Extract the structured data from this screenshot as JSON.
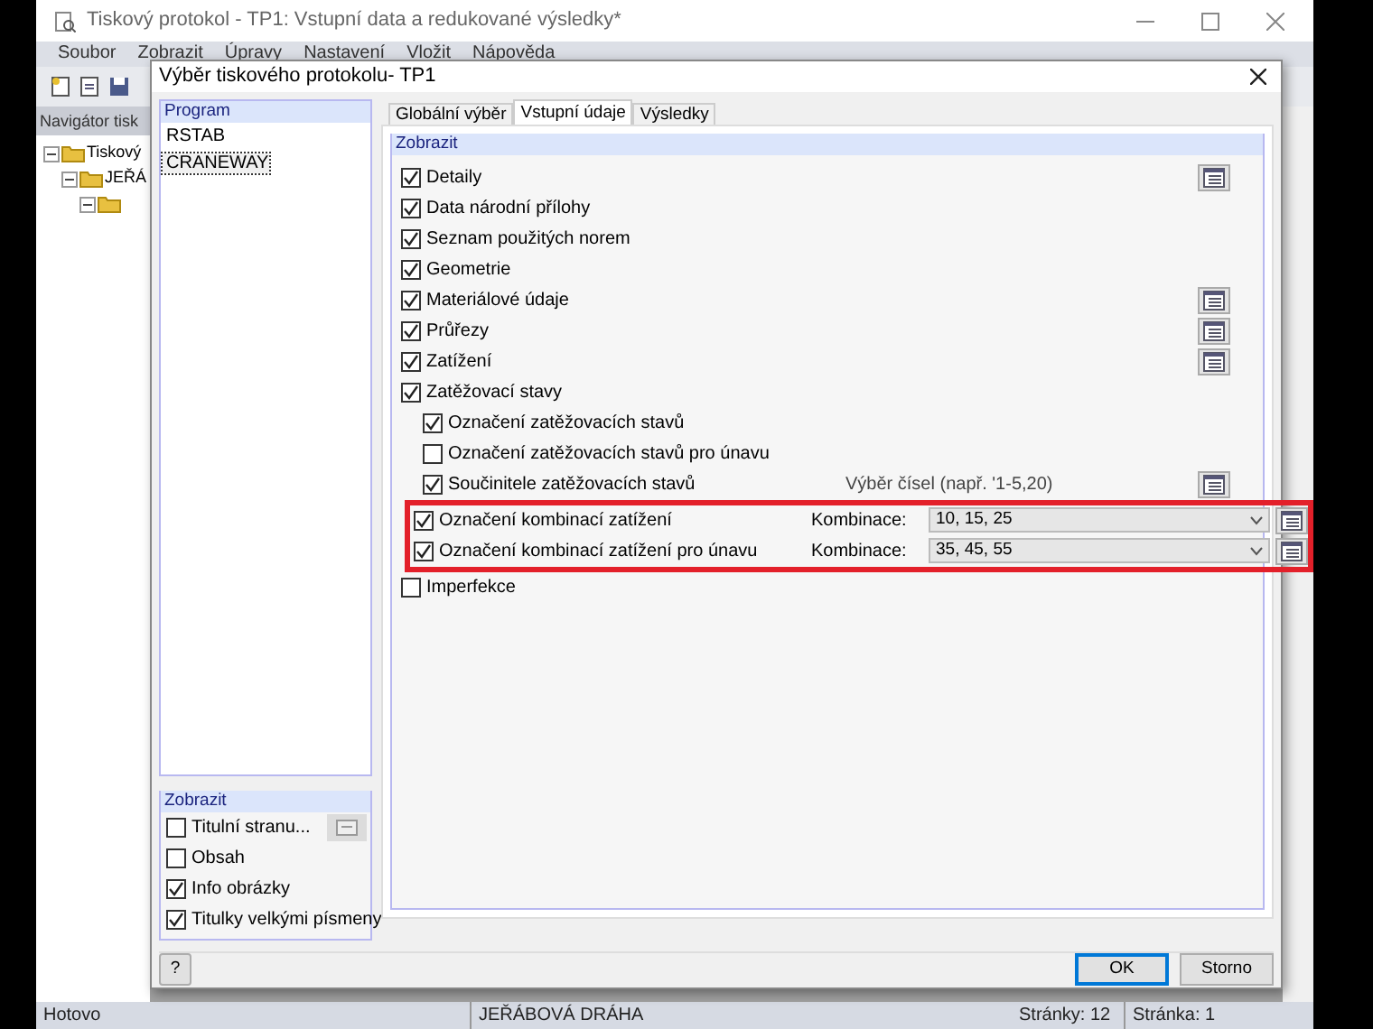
{
  "app": {
    "title": "Tiskový protokol - TP1: Vstupní data a redukované výsledky*",
    "menu": [
      "Soubor",
      "Zobrazit",
      "Úpravy",
      "Nastavení",
      "Vložit",
      "Nápověda"
    ],
    "navigator": {
      "title": "Navigátor tisk",
      "tree": [
        {
          "label": "Tiskový",
          "expanded": true,
          "children": [
            {
              "label": "JEŘÁ",
              "expanded": true,
              "children": [
                {
                  "expanded": true
                }
              ]
            }
          ]
        }
      ]
    },
    "status_bar": [
      "Hotovo",
      "JEŘÁBOVÁ DRÁHA",
      "Stránky: 12",
      "Stránka: 1"
    ]
  },
  "dialog": {
    "title": "Výběr tiskového protokolu- TP1",
    "program": {
      "header": "Program",
      "items": [
        {
          "label": "RSTAB",
          "selected": false
        },
        {
          "label": "CRANEWAY",
          "selected": true
        }
      ]
    },
    "display": {
      "header": "Zobrazit",
      "items": [
        {
          "label": "Titulní stranu...",
          "checked": false,
          "settings_button": true
        },
        {
          "label": "Obsah",
          "checked": false,
          "settings_button": false
        },
        {
          "label": "Info obrázky",
          "checked": true,
          "settings_button": false
        },
        {
          "label": "Titulky velkými písmeny",
          "checked": true,
          "settings_button": false
        }
      ]
    },
    "tabs": [
      {
        "label": "Globální výběr",
        "selected": false
      },
      {
        "label": "Vstupní údaje",
        "selected": true
      },
      {
        "label": "Výsledky",
        "selected": false
      }
    ],
    "section": {
      "header": "Zobrazit",
      "items": [
        {
          "label": "Detaily",
          "checked": true,
          "list_button": true
        },
        {
          "label": "Data národní přílohy",
          "checked": true,
          "list_button": false
        },
        {
          "label": "Seznam použitých norem",
          "checked": true,
          "list_button": false
        },
        {
          "label": "Geometrie",
          "checked": true,
          "list_button": false
        },
        {
          "label": "Materiálové údaje",
          "checked": true,
          "list_button": true
        },
        {
          "label": "Průřezy",
          "checked": true,
          "list_button": true
        },
        {
          "label": "Zatížení",
          "checked": true,
          "list_button": true
        },
        {
          "label": "Zatěžovací stavy",
          "checked": true,
          "list_button": false,
          "children": [
            {
              "label": "Označení zatěžovacích stavů",
              "checked": true,
              "list_button": false,
              "highlighted": false
            },
            {
              "label": "Označení zatěžovacích stavů pro únavu",
              "checked": false,
              "list_button": false,
              "highlighted": false
            },
            {
              "label": "Součinitele zatěžovacích stavů",
              "checked": true,
              "list_button": true,
              "highlighted": false,
              "hint": "Výběr čísel (např. '1-5,20)"
            },
            {
              "label": "Označení kombinací zatížení",
              "checked": true,
              "list_button": true,
              "highlighted": true,
              "combo": {
                "label": "Kombinace:",
                "value": "10, 15, 25"
              }
            },
            {
              "label": "Označení kombinací zatížení pro únavu",
              "checked": true,
              "list_button": true,
              "highlighted": true,
              "combo": {
                "label": "Kombinace:",
                "value": "35, 45, 55"
              }
            }
          ]
        },
        {
          "label": "Imperfekce",
          "checked": false,
          "list_button": false
        }
      ]
    },
    "help_button": "?",
    "buttons": [
      "OK",
      "Storno"
    ]
  }
}
